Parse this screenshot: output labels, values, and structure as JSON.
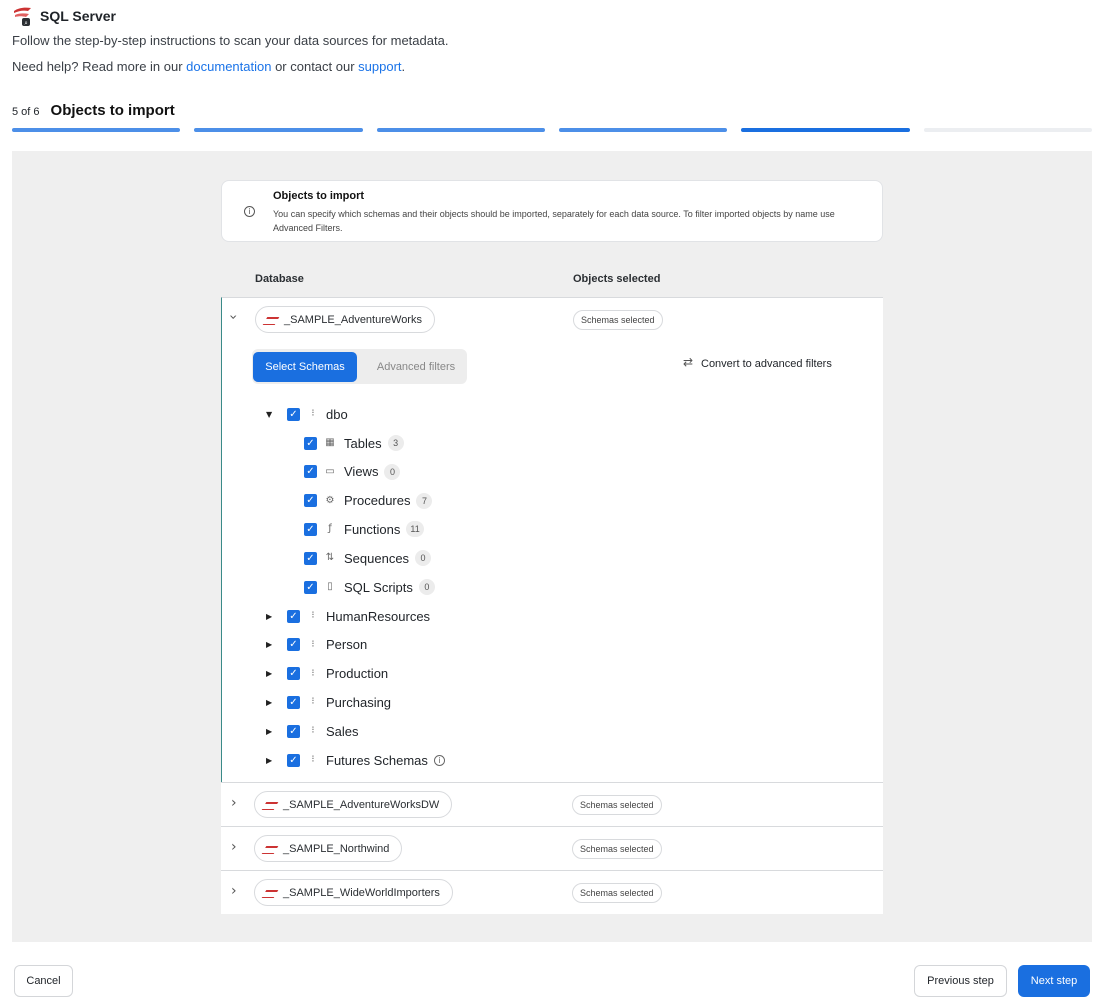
{
  "header": {
    "app_title": "SQL Server",
    "subtitle": "Follow the step-by-step instructions to scan your data sources for metadata.",
    "help_prefix": "Need help? Read more in our ",
    "help_link1": "documentation",
    "help_middle": " or contact our ",
    "help_link2": "support",
    "help_suffix": "."
  },
  "step": {
    "count": "5 of 6",
    "title": "Objects to import",
    "progress": {
      "total": 6,
      "current": 5
    }
  },
  "info": {
    "title": "Objects to import",
    "text": "You can specify which schemas and their objects should be imported, separately for each data source. To filter imported objects by name use Advanced Filters."
  },
  "table": {
    "col_database": "Database",
    "col_objects": "Objects selected"
  },
  "databases": [
    {
      "name": "_SAMPLE_AdventureWorks",
      "status": "Schemas selected"
    },
    {
      "name": "_SAMPLE_AdventureWorksDW",
      "status": "Schemas selected"
    },
    {
      "name": "_SAMPLE_Northwind",
      "status": "Schemas selected"
    },
    {
      "name": "_SAMPLE_WideWorldImporters",
      "status": "Schemas selected"
    }
  ],
  "expanded": {
    "tab_active": "Select Schemas",
    "tab_inactive": "Advanced filters",
    "convert_label": "Convert to advanced filters",
    "root_schema": "dbo",
    "objects": [
      {
        "label": "Tables",
        "count": "3",
        "icon": "table-icon"
      },
      {
        "label": "Views",
        "count": "0",
        "icon": "view-icon"
      },
      {
        "label": "Procedures",
        "count": "7",
        "icon": "gear-icon"
      },
      {
        "label": "Functions",
        "count": "11",
        "icon": "function-icon"
      },
      {
        "label": "Sequences",
        "count": "0",
        "icon": "sequence-icon"
      },
      {
        "label": "SQL Scripts",
        "count": "0",
        "icon": "sql-file-icon"
      }
    ],
    "other_schemas": [
      "HumanResources",
      "Person",
      "Production",
      "Purchasing",
      "Sales",
      "Futures Schemas"
    ]
  },
  "footer": {
    "cancel": "Cancel",
    "previous": "Previous step",
    "next": "Next step"
  }
}
